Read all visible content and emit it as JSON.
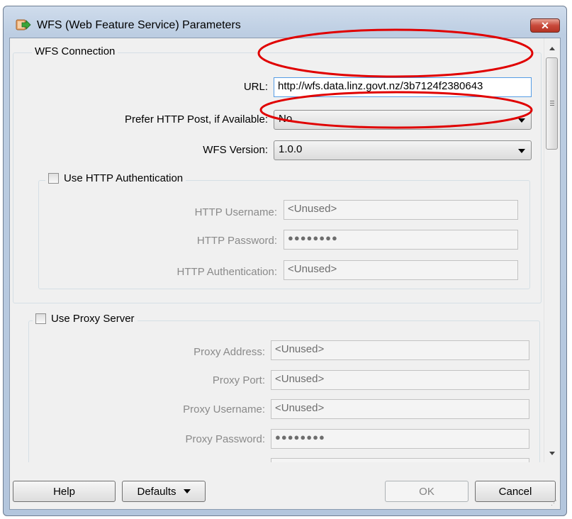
{
  "window": {
    "title": "WFS (Web Feature Service) Parameters",
    "close_label": "✕"
  },
  "wfs_connection": {
    "legend": "WFS Connection",
    "url_label": "URL:",
    "url_value": "http://wfs.data.linz.govt.nz/3b7124f2380643",
    "prefer_post_label": "Prefer HTTP Post, if Available:",
    "prefer_post_value": "No",
    "version_label": "WFS Version:",
    "version_value": "1.0.0"
  },
  "http_auth": {
    "legend": "Use HTTP Authentication",
    "checked": false,
    "username_label": "HTTP Username:",
    "username_value": "<Unused>",
    "password_label": "HTTP Password:",
    "password_value": "●●●●●●●●",
    "auth_label": "HTTP Authentication:",
    "auth_value": "<Unused>"
  },
  "proxy": {
    "legend": "Use Proxy Server",
    "checked": false,
    "address_label": "Proxy Address:",
    "address_value": "<Unused>",
    "port_label": "Proxy Port:",
    "port_value": "<Unused>",
    "username_label": "Proxy Username:",
    "username_value": "<Unused>",
    "password_label": "Proxy Password:",
    "password_value": "●●●●●●●●"
  },
  "buttons": {
    "help": "Help",
    "defaults": "Defaults",
    "ok": "OK",
    "cancel": "Cancel"
  },
  "colors": {
    "annotation_red": "#e00000",
    "title_gradient_top": "#cfdcec",
    "close_red": "#c8493a"
  }
}
